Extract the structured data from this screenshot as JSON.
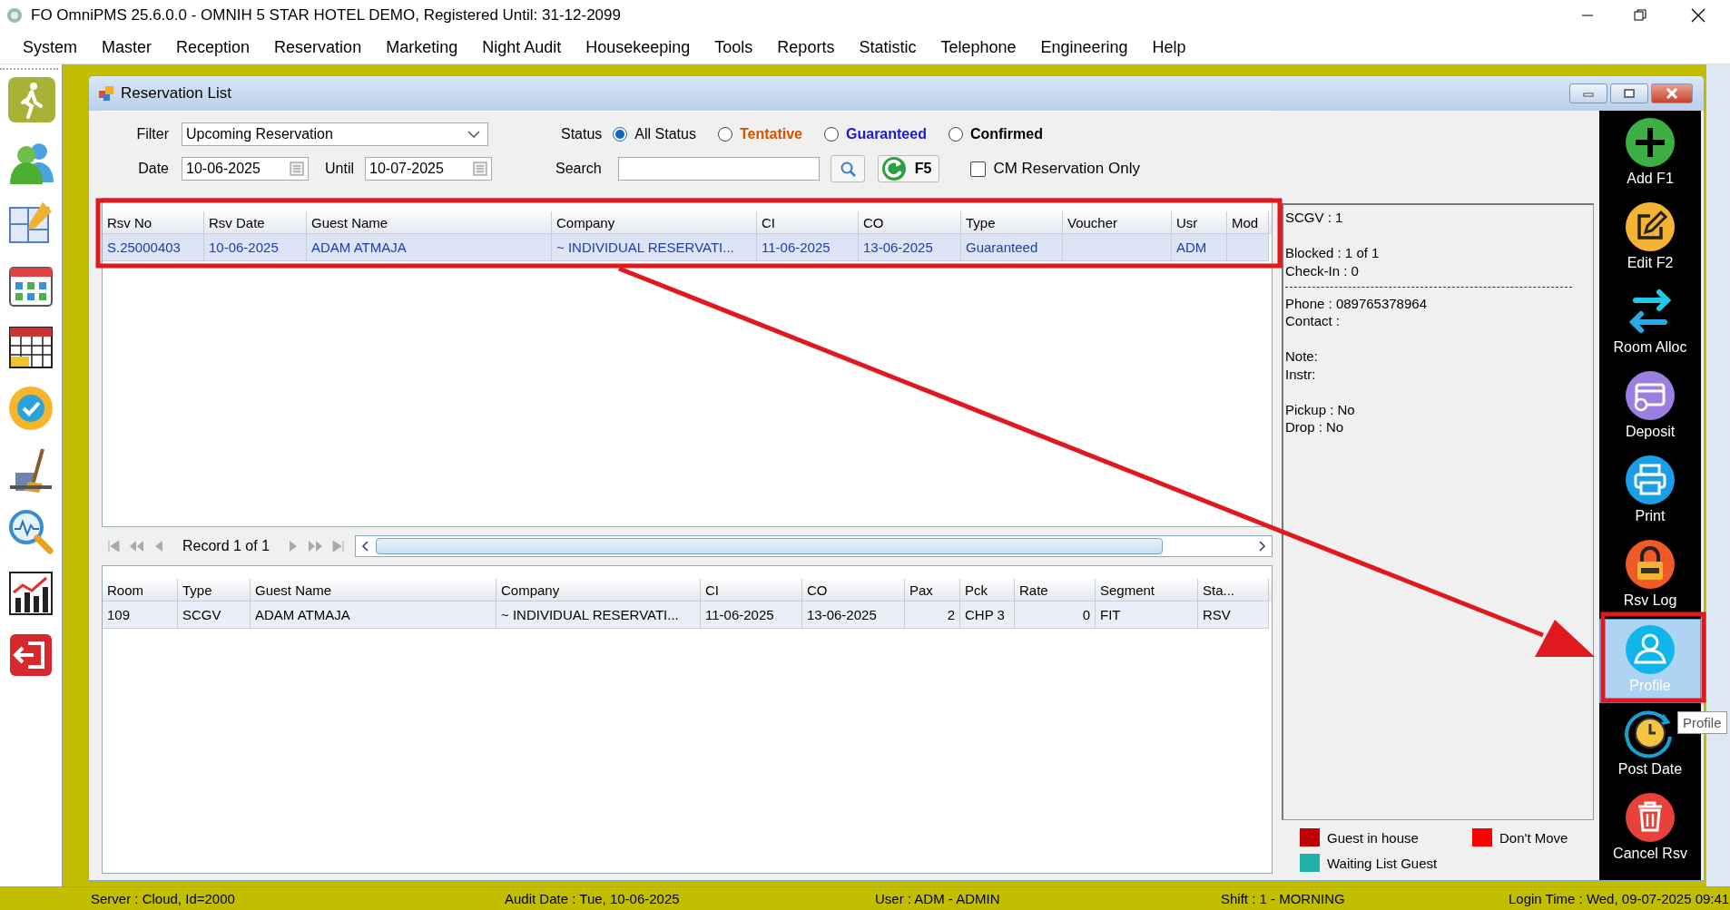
{
  "app": {
    "title": "FO OmniPMS 25.6.0.0 - OMNIH 5 STAR HOTEL DEMO, Registered Until: 31-12-2099"
  },
  "menu": [
    "System",
    "Master",
    "Reception",
    "Reservation",
    "Marketing",
    "Night Audit",
    "Housekeeping",
    "Tools",
    "Reports",
    "Statistic",
    "Telephone",
    "Engineering",
    "Help"
  ],
  "dock": [
    {
      "kind": "walkin"
    },
    {
      "kind": "guests"
    },
    {
      "kind": "floorplan"
    },
    {
      "kind": "calendar"
    },
    {
      "kind": "yearplan"
    },
    {
      "kind": "available"
    },
    {
      "kind": "housekeeping"
    },
    {
      "kind": "search"
    },
    {
      "kind": "report"
    },
    {
      "kind": "exit"
    }
  ],
  "window": {
    "title": "Reservation List"
  },
  "filter": {
    "label": "Filter",
    "value": "Upcoming Reservation"
  },
  "date": {
    "label": "Date",
    "from": "10-06-2025",
    "until_label": "Until",
    "until": "10-07-2025"
  },
  "status": {
    "label": "Status",
    "options": [
      {
        "label": "All Status",
        "selected": true,
        "color": "#000000"
      },
      {
        "label": "Tentative",
        "selected": false,
        "color": "#d35400"
      },
      {
        "label": "Guaranteed",
        "selected": false,
        "color": "#1a1acc"
      },
      {
        "label": "Confirmed",
        "selected": false,
        "color": "#000000"
      }
    ]
  },
  "search": {
    "label": "Search"
  },
  "refresh": {
    "label": "F5"
  },
  "cm_only": {
    "label": "CM Reservation Only",
    "checked": false
  },
  "reservations": {
    "columns": [
      "Rsv No",
      "Rsv Date",
      "Guest Name",
      "Company",
      "CI",
      "CO",
      "Type",
      "Voucher",
      "Usr",
      "Mod"
    ],
    "rows": [
      {
        "selected": true,
        "cells": [
          "S.25000403",
          "10-06-2025",
          "ADAM ATMAJA",
          "~ INDIVIDUAL RESERVATI...",
          "11-06-2025",
          "13-06-2025",
          "Guaranteed",
          "",
          "ADM",
          ""
        ]
      }
    ]
  },
  "navigator": {
    "record": "Record 1 of 1"
  },
  "rooms": {
    "columns": [
      "Room",
      "Type",
      "Guest Name",
      "Company",
      "CI",
      "CO",
      "Pax",
      "Pck",
      "Rate",
      "Segment",
      "Sta..."
    ],
    "rows": [
      {
        "selected": false,
        "cells": [
          "109",
          "SCGV",
          "ADAM ATMAJA",
          "~ INDIVIDUAL RESERVATI...",
          "11-06-2025",
          "13-06-2025",
          "2",
          "CHP 3",
          "0",
          "FIT",
          "RSV"
        ]
      }
    ]
  },
  "info": {
    "blocks": [
      {
        "lines": [
          "SCGV : 1"
        ],
        "rule": false
      },
      {
        "lines": [
          "Blocked : 1 of 1",
          "Check-In : 0"
        ],
        "rule": true
      },
      {
        "lines": [
          "Phone : 089765378964",
          "Contact :"
        ],
        "rule": false
      },
      {
        "lines": [
          "Note:",
          "Instr:"
        ],
        "rule": false
      },
      {
        "lines": [
          "Pickup : No",
          "Drop : No"
        ],
        "rule": false
      }
    ]
  },
  "legend": [
    {
      "label": "Guest in house",
      "color": "#c00000"
    },
    {
      "label": "Don't Move",
      "color": "#ff0000"
    },
    {
      "label": "Waiting List Guest",
      "color": "#20b2aa"
    }
  ],
  "actions": [
    {
      "label": "Add F1",
      "kind": "add",
      "selected": false
    },
    {
      "label": "Edit F2",
      "kind": "edit",
      "selected": false
    },
    {
      "label": "Room Alloc",
      "kind": "alloc",
      "selected": false
    },
    {
      "label": "Deposit",
      "kind": "deposit",
      "selected": false
    },
    {
      "label": "Print",
      "kind": "print",
      "selected": false
    },
    {
      "label": "Rsv Log",
      "kind": "log",
      "selected": false
    },
    {
      "label": "Profile",
      "kind": "profile",
      "selected": true
    },
    {
      "label": "Post Date",
      "kind": "postdate",
      "selected": false
    },
    {
      "label": "Cancel Rsv",
      "kind": "cancel",
      "selected": false
    }
  ],
  "tooltip": {
    "text": "Profile"
  },
  "status_bar": [
    "Server : Cloud, Id=2000",
    "Audit Date : Tue, 10-06-2025",
    "User : ADM - ADMIN",
    "Shift : 1 - MORNING",
    "Login Time : Wed, 09-07-2025 09:41"
  ]
}
